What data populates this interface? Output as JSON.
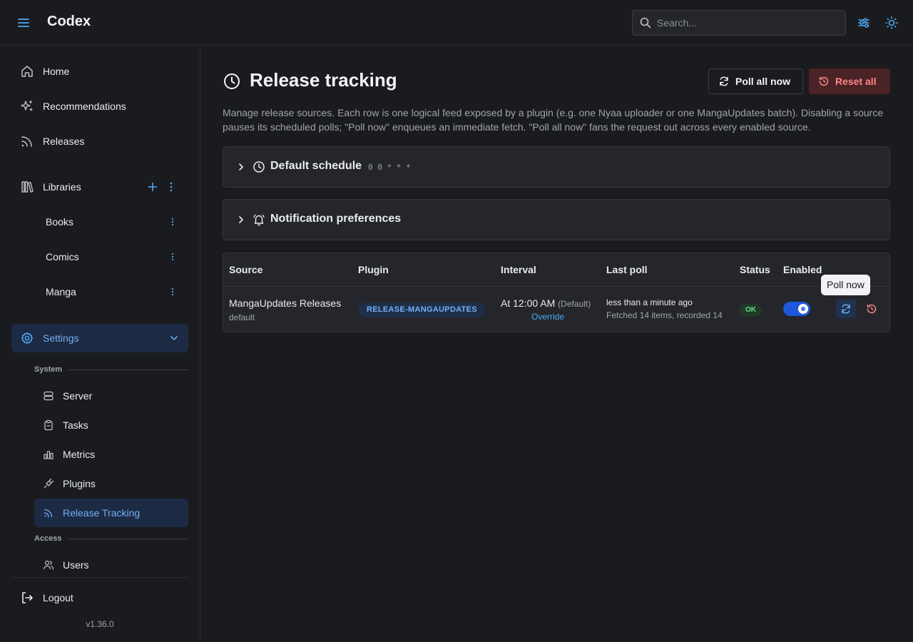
{
  "app": {
    "title": "Codex"
  },
  "header": {
    "search_placeholder": "Search..."
  },
  "sidebar": {
    "nav": [
      {
        "label": "Home"
      },
      {
        "label": "Recommendations"
      },
      {
        "label": "Releases"
      }
    ],
    "libraries": {
      "label": "Libraries",
      "items": [
        {
          "label": "Books"
        },
        {
          "label": "Comics"
        },
        {
          "label": "Manga"
        }
      ]
    },
    "settings": {
      "label": "Settings",
      "system_label": "System",
      "system_items": [
        {
          "label": "Server"
        },
        {
          "label": "Tasks"
        },
        {
          "label": "Metrics"
        },
        {
          "label": "Plugins"
        },
        {
          "label": "Release Tracking"
        }
      ],
      "access_label": "Access",
      "access_items": [
        {
          "label": "Users"
        }
      ]
    },
    "logout_label": "Logout",
    "version": "v1.36.0"
  },
  "page": {
    "title": "Release tracking",
    "poll_all_label": "Poll all now",
    "reset_all_label": "Reset all",
    "description": "Manage release sources. Each row is one logical feed exposed by a plugin (e.g. one Nyaa uploader or one MangaUpdates batch). Disabling a source pauses its scheduled polls; \"Poll now\" enqueues an immediate fetch. \"Poll all now\" fans the request out across every enabled source.",
    "default_schedule": {
      "title": "Default schedule",
      "cron": "0 0 * * *"
    },
    "notification_prefs": {
      "title": "Notification preferences"
    }
  },
  "table": {
    "headers": [
      "Source",
      "Plugin",
      "Interval",
      "Last poll",
      "Status",
      "Enabled"
    ],
    "rows": [
      {
        "source": "MangaUpdates Releases",
        "source_sub": "default",
        "plugin": "RELEASE-MANGAUPDATES",
        "interval": "At 12:00 AM",
        "interval_default": "(Default)",
        "override_label": "Override",
        "last_poll": "less than a minute ago",
        "last_poll_detail": "Fetched 14 items, recorded 14",
        "status": "OK",
        "enabled": true
      }
    ]
  },
  "tooltip": {
    "text": "Poll now"
  },
  "colors": {
    "accent": "#4dabf7",
    "active_bg": "#1c2a44",
    "danger": "#ff8787",
    "ok": "#69db7c",
    "toggle_on": "#1c58d9"
  }
}
